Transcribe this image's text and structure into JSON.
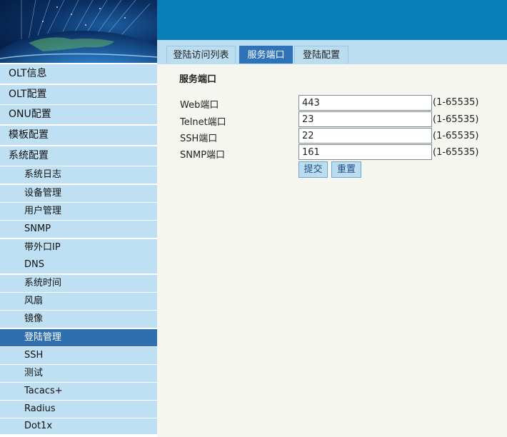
{
  "tabs": [
    {
      "label": "登陆访问列表"
    },
    {
      "label": "服务端口"
    },
    {
      "label": "登陆配置"
    }
  ],
  "sidebar": {
    "items": [
      {
        "label": "OLT信息"
      },
      {
        "label": "OLT配置"
      },
      {
        "label": "ONU配置"
      },
      {
        "label": "模板配置"
      },
      {
        "label": "系统配置"
      },
      {
        "label": "系统日志"
      },
      {
        "label": "设备管理"
      },
      {
        "label": "用户管理"
      },
      {
        "label": "SNMP"
      },
      {
        "label": "带外口IP"
      },
      {
        "label": "DNS"
      },
      {
        "label": "系统时间"
      },
      {
        "label": "风扇"
      },
      {
        "label": "镜像"
      },
      {
        "label": "登陆管理"
      },
      {
        "label": "SSH"
      },
      {
        "label": "测试"
      },
      {
        "label": "Tacacs+"
      },
      {
        "label": "Radius"
      },
      {
        "label": "Dot1x"
      }
    ],
    "active_index": 14
  },
  "form": {
    "title": "服务端口",
    "rows": [
      {
        "label": "Web端口",
        "value": "443",
        "range": "(1-65535)"
      },
      {
        "label": "Telnet端口",
        "value": "23",
        "range": "(1-65535)"
      },
      {
        "label": "SSH端口",
        "value": "22",
        "range": "(1-65535)"
      },
      {
        "label": "SNMP端口",
        "value": "161",
        "range": "(1-65535)"
      }
    ],
    "submit_label": "提交",
    "reset_label": "重置"
  },
  "colors": {
    "banner": "#0a7fb8",
    "tabbar": "#bcdcef",
    "nav_bg": "#bfe0f3",
    "nav_active": "#2e6fb0",
    "content_bg": "#f4f6ef"
  },
  "icons": [
    "globe-network-logo"
  ]
}
